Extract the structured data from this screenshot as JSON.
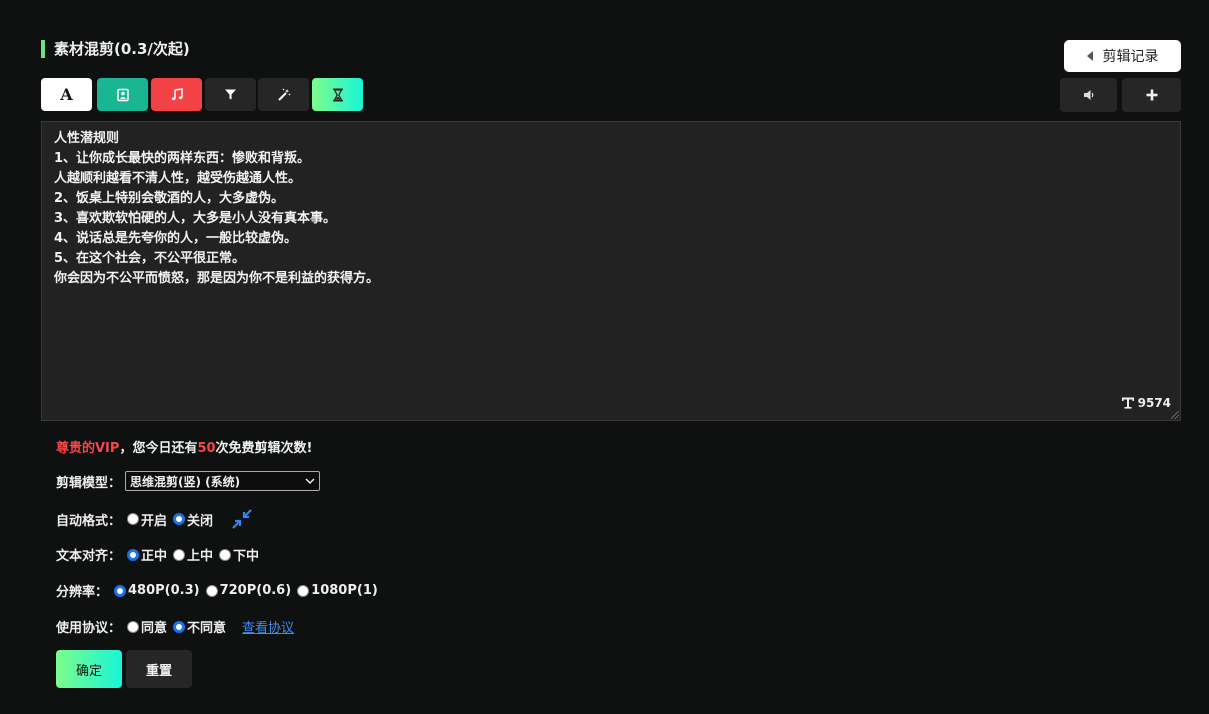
{
  "header": {
    "title": "素材混剪(0.3/次起)",
    "history_label": "剪辑记录"
  },
  "toolbar": {
    "text_glyph": "A",
    "tools": [
      "text-tool",
      "image-tool",
      "music-tool",
      "filter-tool",
      "magic-tool",
      "timer-tool"
    ]
  },
  "editor": {
    "content": "人性潜规则\n1、让你成长最快的两样东西：惨败和背叛。\n人越顺利越看不清人性，越受伤越通人性。\n2、饭桌上特别会敬酒的人，大多虚伪。\n3、喜欢欺软怕硬的人，大多是小人没有真本事。\n4、说话总是先夸你的人，一般比较虚伪。\n5、在这个社会，不公平很正常。\n你会因为不公平而愤怒，那是因为你不是利益的获得方。",
    "char_count": "9574"
  },
  "notice": {
    "vip": "尊贵的VIP",
    "middle": "，您今日还有",
    "count": "50",
    "suffix": "次免费剪辑次数!"
  },
  "form": {
    "model": {
      "label": "剪辑模型：",
      "selected": "思维混剪(竖) (系统)"
    },
    "auto_format": {
      "label": "自动格式：",
      "options": [
        "开启",
        "关闭"
      ],
      "selected": 1
    },
    "text_align": {
      "label": "文本对齐：",
      "options": [
        "正中",
        "上中",
        "下中"
      ],
      "selected": 0
    },
    "resolution": {
      "label": "分辨率：",
      "options": [
        "480P(0.3)",
        "720P(0.6)",
        "1080P(1)"
      ],
      "selected": 0
    },
    "agreement": {
      "label": "使用协议：",
      "options": [
        "同意",
        "不同意"
      ],
      "selected": 1,
      "link": "查看协议"
    }
  },
  "actions": {
    "confirm": "确定",
    "reset": "重置"
  },
  "colors": {
    "accent_green": "#6ee07f",
    "gradient_start": "#7dfc8c",
    "gradient_end": "#18f5d6",
    "teal": "#1ab593",
    "red": "#f24245",
    "link_blue": "#3d8cf0"
  }
}
